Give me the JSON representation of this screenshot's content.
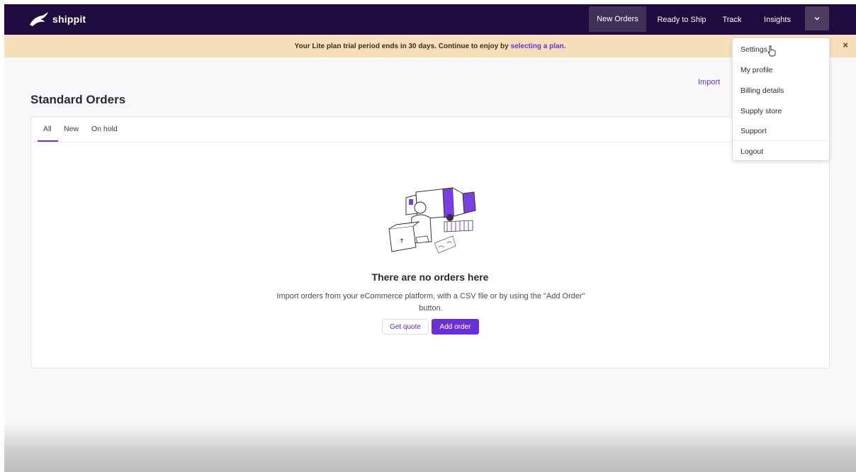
{
  "app": {
    "logo_text": "shippit"
  },
  "nav": {
    "items": [
      {
        "label": "New Orders",
        "active": true
      },
      {
        "label": "Ready to Ship",
        "active": false
      },
      {
        "label": "Track",
        "active": false
      },
      {
        "label": "Insights",
        "active": false
      }
    ],
    "toggle_icon": "chevron-down-icon"
  },
  "banner": {
    "text": "Your Lite plan trial period ends in 30 days. Continue to enjoy by",
    "link": "selecting a plan.",
    "close": "×"
  },
  "page": {
    "title": "Standard Orders",
    "import_label": "Import",
    "tabs": [
      {
        "label": "All",
        "active": true
      },
      {
        "label": "New",
        "active": false
      },
      {
        "label": "On hold",
        "active": false
      }
    ]
  },
  "empty_state": {
    "title": "There are no orders here",
    "description": "Import orders from your eCommerce platform, with a CSV file or by using the \"Add Order\" button.",
    "get_quote_label": "Get quote",
    "add_order_label": "Add order"
  },
  "dropdown": {
    "items": [
      "Settings",
      "My profile",
      "Billing details",
      "Supply store",
      "Support",
      "Logout"
    ]
  },
  "colors": {
    "nav_bg": "#1f0b3d",
    "accent": "#6b2fd6",
    "banner_bg": "#f6dfb9"
  }
}
